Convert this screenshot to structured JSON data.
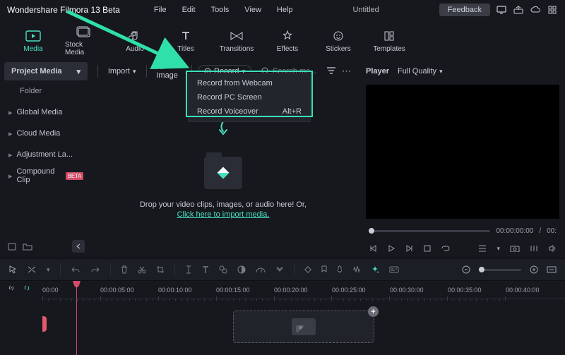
{
  "app_name": "Wondershare Filmora 13 Beta",
  "menu": {
    "file": "File",
    "edit": "Edit",
    "tools": "Tools",
    "view": "View",
    "help": "Help"
  },
  "center_title": "Untitled",
  "feedback": "Feedback",
  "tabs": {
    "media": "Media",
    "stockmedia": "Stock Media",
    "audio": "Audio",
    "titles": "Titles",
    "transitions": "Transitions",
    "effects": "Effects",
    "stickers": "Stickers",
    "templates": "Templates"
  },
  "sidebar": {
    "project": "Project Media",
    "folder": "Folder",
    "global": "Global Media",
    "cloud": "Cloud Media",
    "adjust": "Adjustment La...",
    "compound": "Compound Clip",
    "compound_badge": "BETA"
  },
  "mp": {
    "import": "Import",
    "aiimage": "AI Image",
    "record": "Record",
    "search_placeholder": "Search me..."
  },
  "dropdown": {
    "webcam": "Record from Webcam",
    "screen": "Record PC Screen",
    "voiceover": "Record Voiceover",
    "voiceover_key": "Alt+R"
  },
  "drop": {
    "text": "Drop your video clips, images, or audio here! Or,",
    "link": "Click here to import media."
  },
  "preview": {
    "player": "Player",
    "quality": "Full Quality"
  },
  "time": {
    "current": "00:00:00:00",
    "total": "00:"
  },
  "ruler": [
    "00:00",
    "00:00:05:00",
    "00:00:10:00",
    "00:00:15:00",
    "00:00:20:00",
    "00:00:25:00",
    "00:00:30:00",
    "00:00:35:00",
    "00:00:40:00"
  ]
}
